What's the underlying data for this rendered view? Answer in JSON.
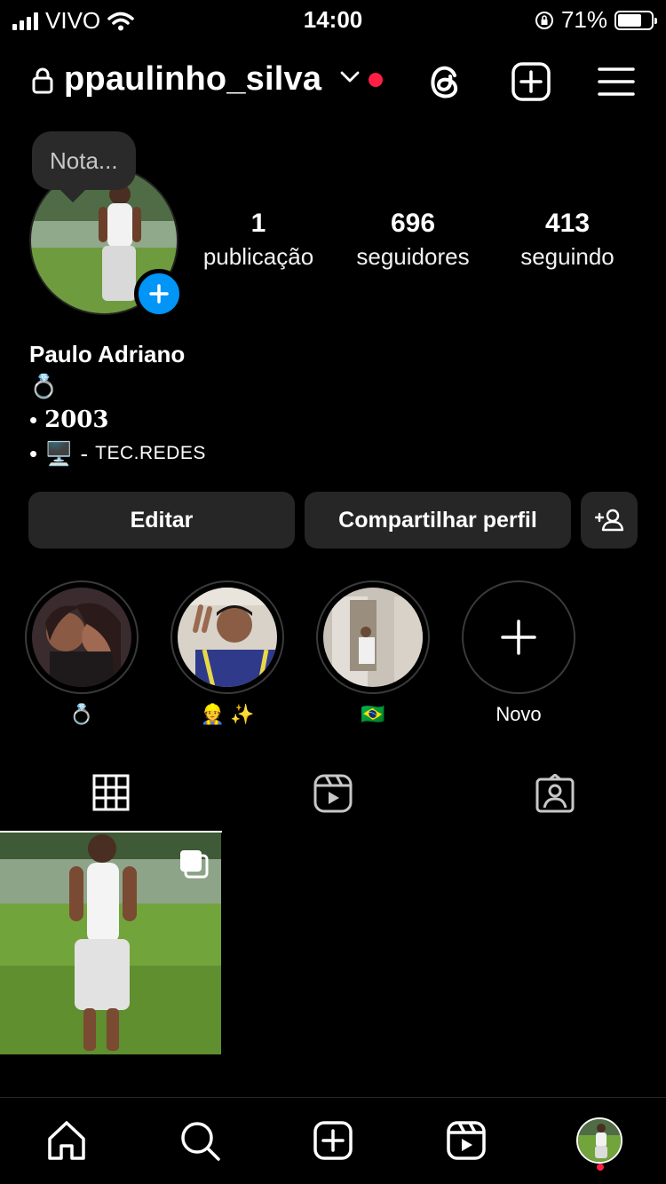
{
  "status_bar": {
    "carrier": "VIVO",
    "time": "14:00",
    "battery": "71%",
    "battery_level": 0.71
  },
  "header": {
    "username": "ppaulinho_silva",
    "notification_dot_color": "#ff1f45",
    "icons": [
      "lock-icon",
      "chevron-down-icon",
      "threads-icon",
      "create-post-icon",
      "menu-icon"
    ]
  },
  "profile": {
    "note_placeholder": "Nota...",
    "stats": [
      {
        "value": "1",
        "label": "publicação"
      },
      {
        "value": "696",
        "label": "seguidores"
      },
      {
        "value": "413",
        "label": "seguindo"
      }
    ],
    "name": "Paulo Adriano",
    "bio": {
      "line1_emoji": "💍",
      "bullet": "•",
      "year": "2003",
      "computer_emoji": "🖥️",
      "dash": "-",
      "course": "TEC.REDES"
    }
  },
  "actions": {
    "edit": "Editar",
    "share": "Compartilhar perfil"
  },
  "highlights": [
    {
      "caption": "💍"
    },
    {
      "caption": "👷 ✨"
    },
    {
      "caption": "🇧🇷"
    },
    {
      "caption": "Novo"
    }
  ],
  "tabs": [
    "grid-icon",
    "reels-icon",
    "tagged-icon"
  ],
  "colors": {
    "accent_blue": "#0095f6",
    "button_bg": "#262626",
    "alert_red": "#ff1f45"
  }
}
